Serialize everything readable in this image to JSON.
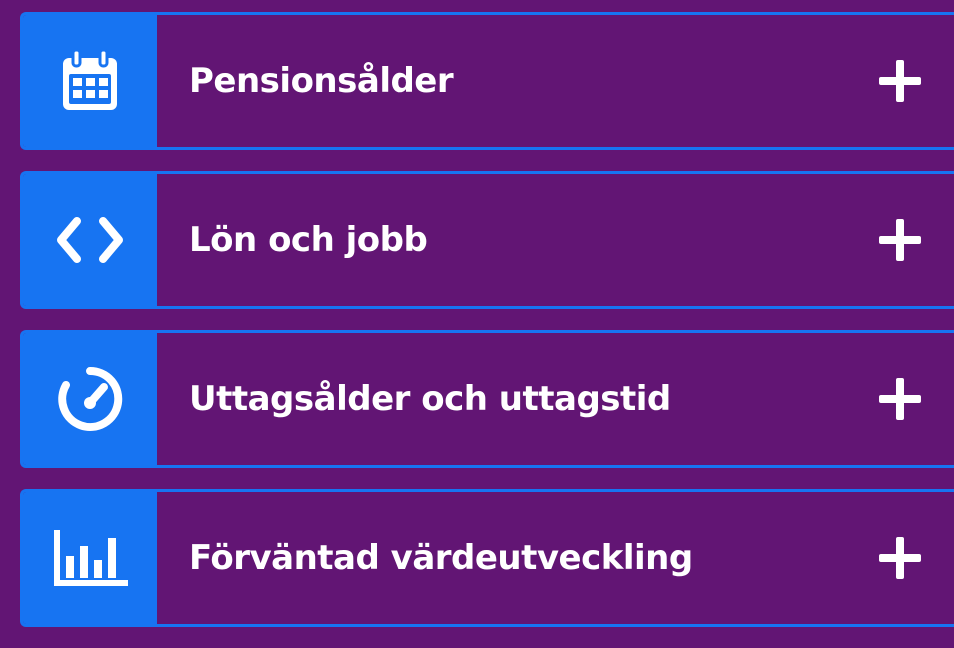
{
  "accordion": {
    "items": [
      {
        "label": "Pensionsålder",
        "icon": "calendar-icon",
        "toggle_icon": "plus-icon"
      },
      {
        "label": "Lön och jobb",
        "icon": "code-brackets-icon",
        "toggle_icon": "plus-icon"
      },
      {
        "label": "Uttagsålder och uttagstid",
        "icon": "gauge-icon",
        "toggle_icon": "plus-icon"
      },
      {
        "label": "Förväntad värdeutveckling",
        "icon": "bar-chart-icon",
        "toggle_icon": "plus-icon"
      }
    ]
  },
  "colors": {
    "background": "#621574",
    "accent": "#1774f2",
    "text": "#ffffff"
  }
}
